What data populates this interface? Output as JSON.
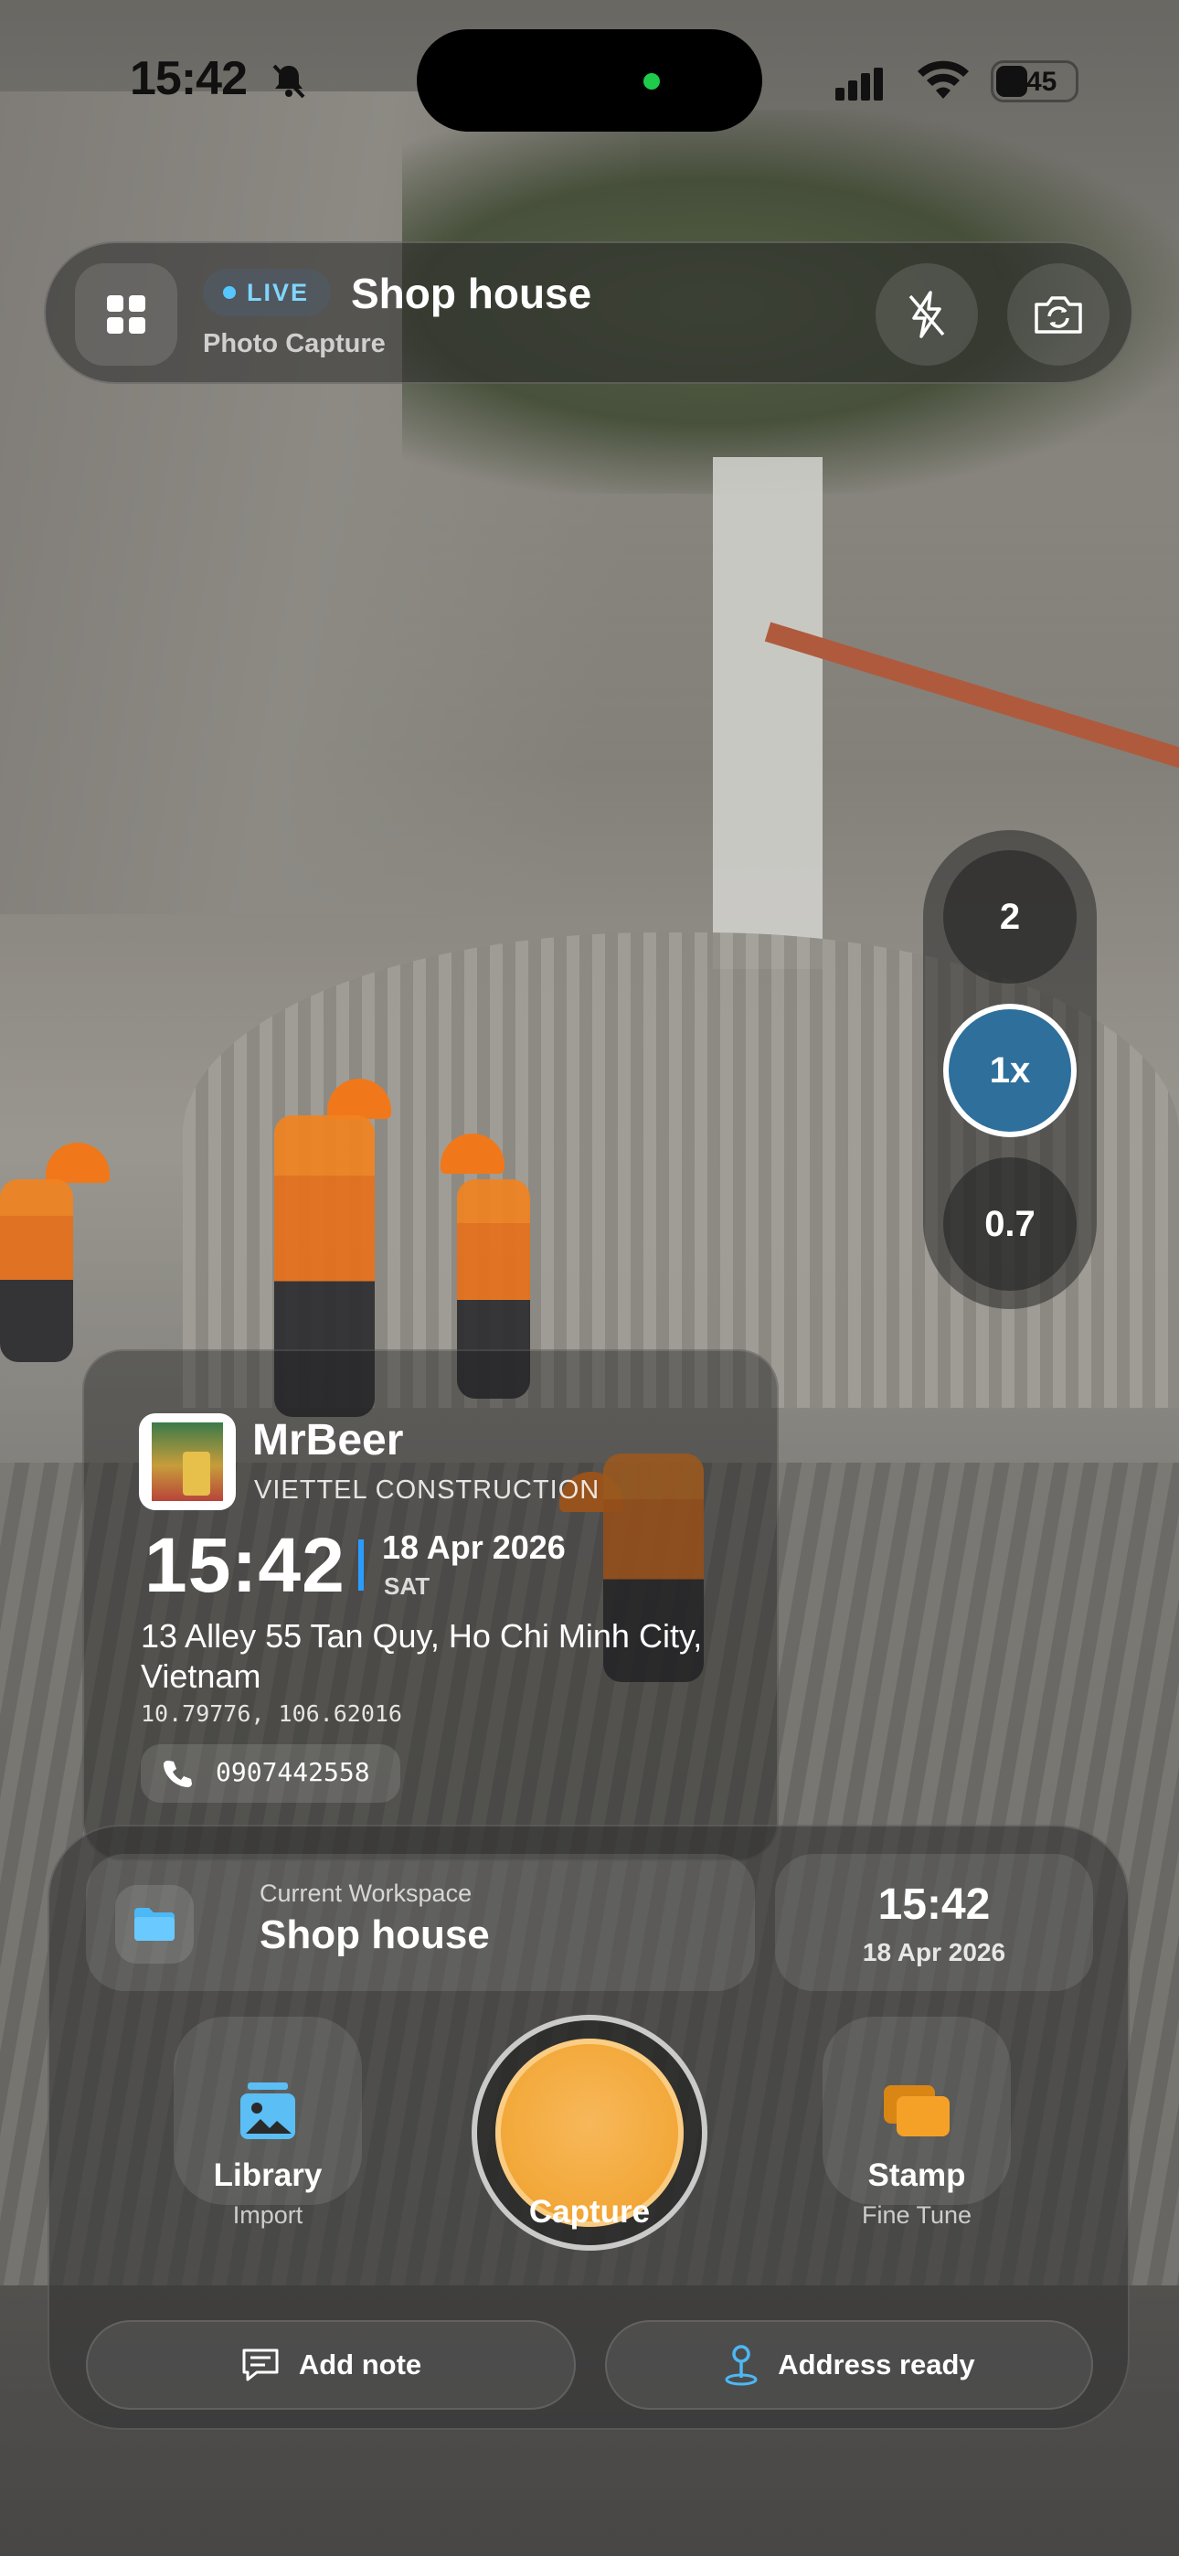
{
  "status_bar": {
    "time": "15:42",
    "battery_level": "45"
  },
  "top_bar": {
    "live_badge": "LIVE",
    "title": "Shop house",
    "subtitle": "Photo Capture"
  },
  "zoom": {
    "options": [
      "2",
      "1x",
      "0.7"
    ],
    "selected": "1x"
  },
  "stamp": {
    "name": "MrBeer",
    "company": "VIETTEL CONSTRUCTION",
    "time": "15:42",
    "date": "18 Apr 2026",
    "day": "SAT",
    "address": "13 Alley 55 Tan Quy, Ho Chi Minh City, Vietnam",
    "coordinates": "10.79776, 106.62016",
    "phone": "0907442558"
  },
  "workspace": {
    "label": "Current Workspace",
    "name": "Shop house",
    "time": "15:42",
    "date": "18 Apr 2026"
  },
  "actions": {
    "library_label": "Library",
    "library_sub": "Import",
    "capture_label": "Capture",
    "stamp_label": "Stamp",
    "stamp_sub": "Fine Tune",
    "note_label": "Add note",
    "address_label": "Address ready"
  },
  "colors": {
    "accent_blue": "#2b9cff",
    "live_blue": "#56c6ff",
    "shutter": "#f3a93b",
    "stamp_orange": "#f39a21",
    "zoom_active": "#2e6f9c"
  }
}
